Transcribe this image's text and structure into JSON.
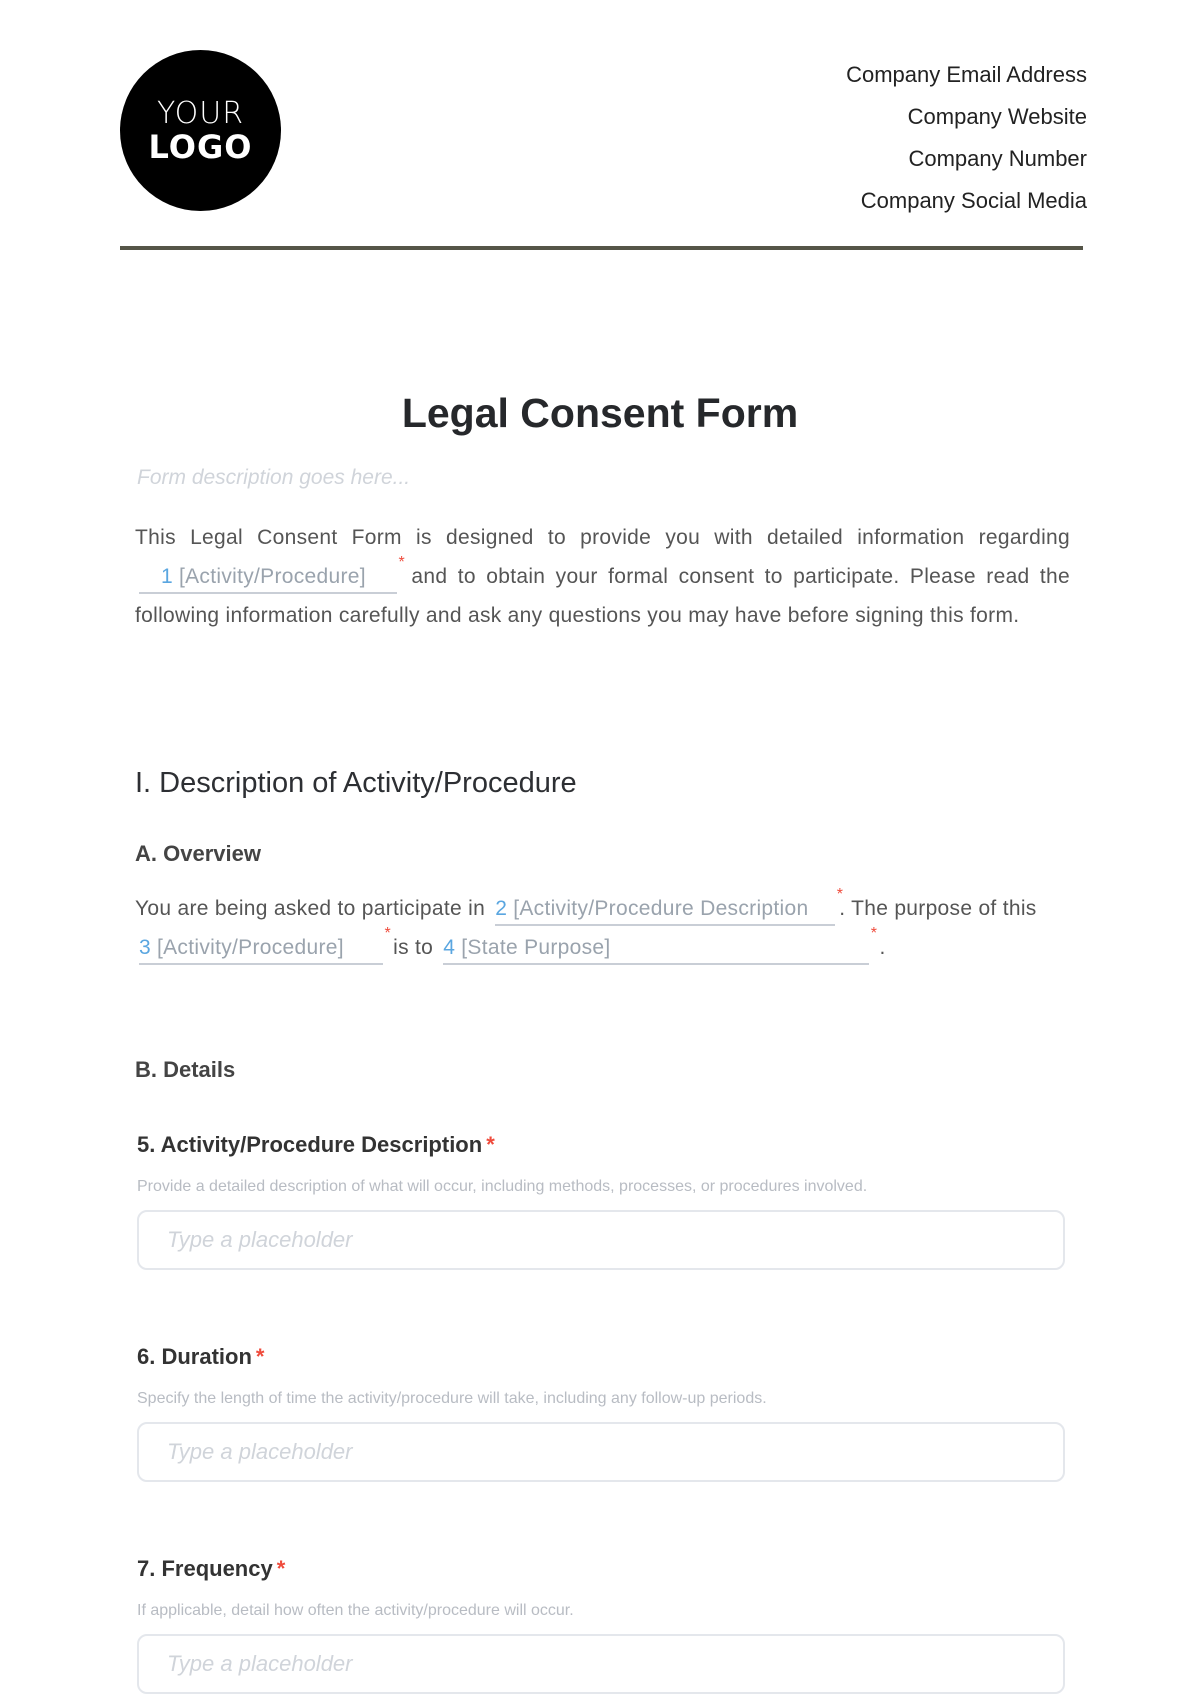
{
  "header": {
    "logo": {
      "line1": "YOUR",
      "line2": "LOGO"
    },
    "company": [
      "Company Email Address",
      "Company Website",
      "Company Number",
      "Company Social Media"
    ]
  },
  "form": {
    "title": "Legal Consent Form",
    "description_placeholder": "Form description goes here...",
    "intro": {
      "before": "This Legal Consent Form is designed to provide you with detailed information regarding",
      "field1": {
        "num": "1",
        "label": "[Activity/Procedure]",
        "required": "*"
      },
      "after": "and to obtain your formal consent to participate. Please read the following information carefully and ask any questions you may have before signing this form."
    },
    "section1": {
      "title": "I. Description of Activity/Procedure",
      "overview": {
        "title": "A. Overview",
        "t1": "You are being asked to participate in",
        "field2": {
          "num": "2",
          "label": "[Activity/Procedure Description",
          "required": "*"
        },
        "t2": ". The purpose of this",
        "field3": {
          "num": "3",
          "label": "[Activity/Procedure]",
          "required": "*"
        },
        "t3": "is to",
        "field4": {
          "num": "4",
          "label": "[State Purpose]",
          "required": "*"
        },
        "t4": "."
      },
      "details": {
        "title": "B. Details",
        "questions": [
          {
            "label": "5. Activity/Procedure Description",
            "required": "*",
            "help": "Provide a detailed description of what will occur, including methods, processes, or procedures involved.",
            "placeholder": "Type a placeholder"
          },
          {
            "label": "6. Duration",
            "required": "*",
            "help": "Specify the length of time the activity/procedure will take, including any follow-up periods.",
            "placeholder": "Type a placeholder"
          },
          {
            "label": "7. Frequency",
            "required": "*",
            "help": "If applicable, detail how often the activity/procedure will occur.",
            "placeholder": "Type a placeholder"
          }
        ]
      }
    }
  },
  "colors": {
    "accent": "#5aa6e0",
    "required": "#ef4b3c",
    "divider": "#555548"
  }
}
